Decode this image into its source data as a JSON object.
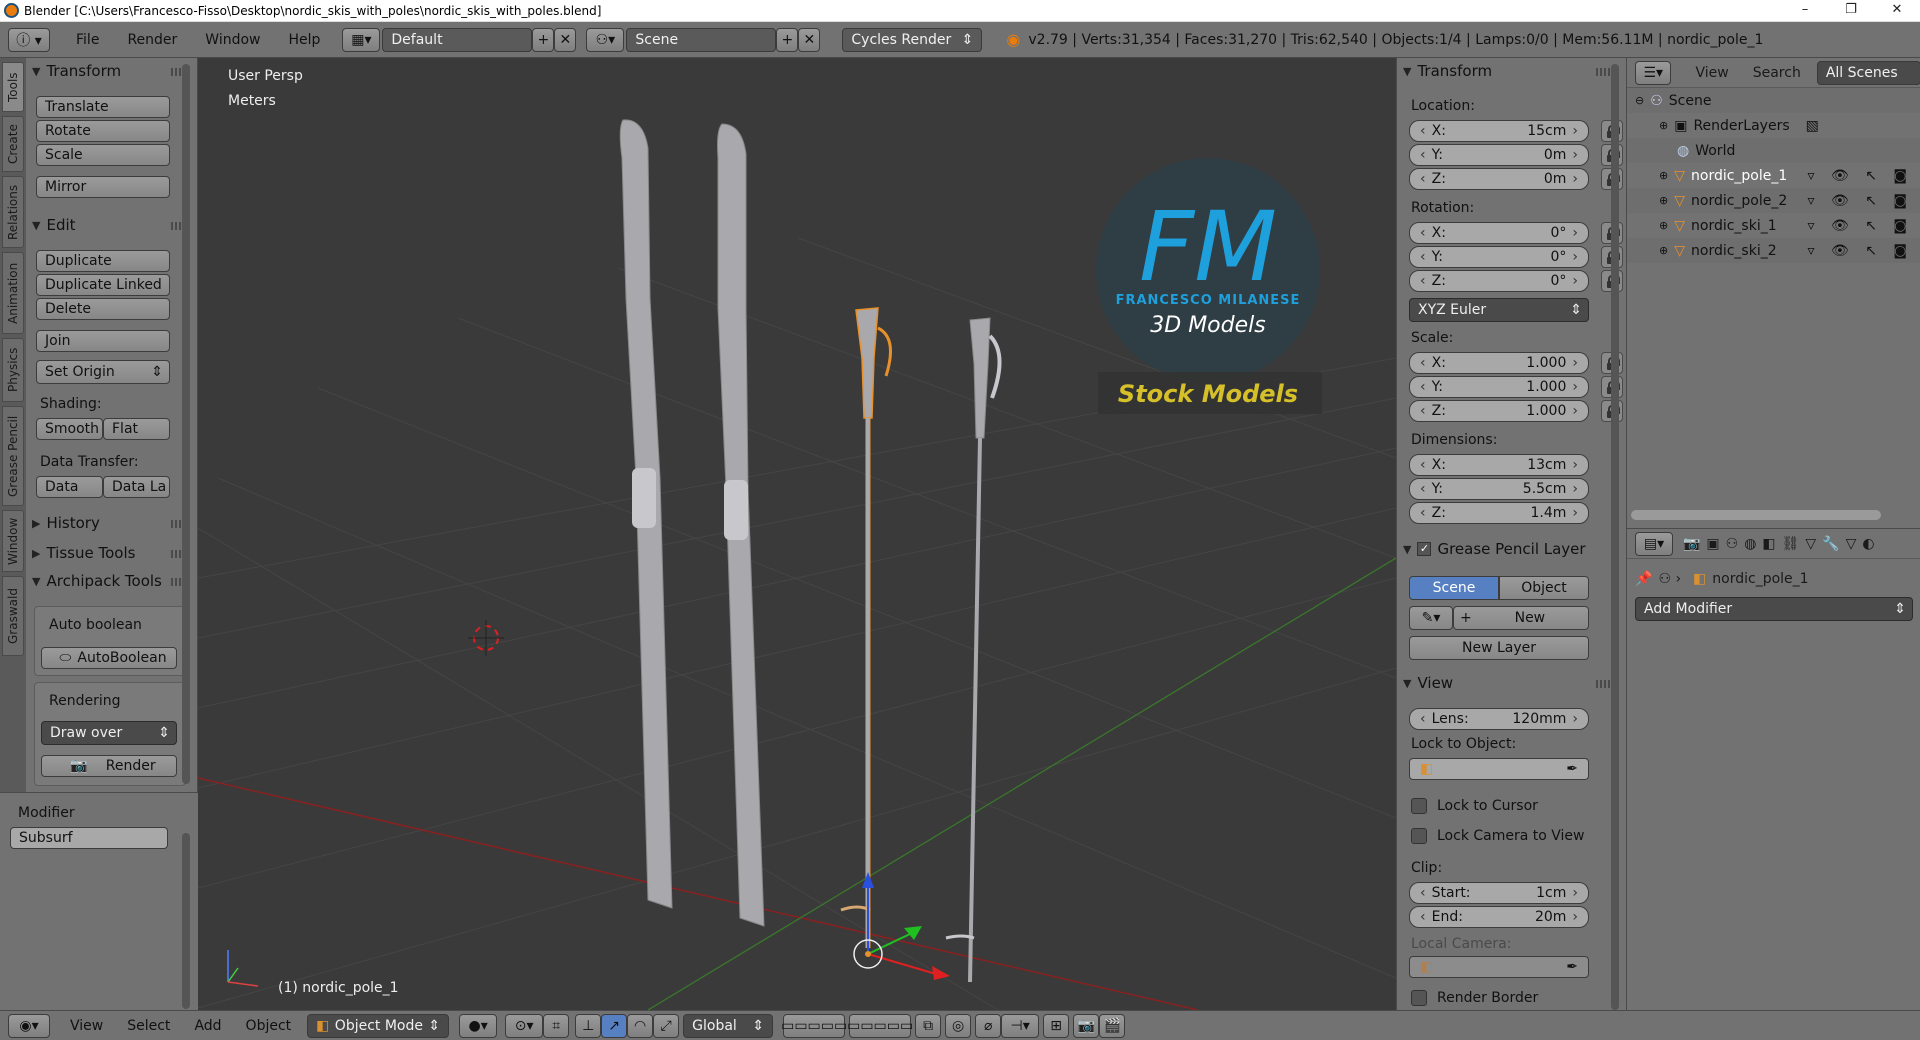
{
  "window": {
    "title": "Blender [C:\\Users\\Francesco-Fisso\\Desktop\\nordic_skis_with_poles\\nordic_skis_with_poles.blend]",
    "minimize": "–",
    "maximize": "❐",
    "close": "✕"
  },
  "header": {
    "menus": [
      "File",
      "Render",
      "Window",
      "Help"
    ],
    "layout": "Default",
    "scene": "Scene",
    "engine": "Cycles Render",
    "stats": "v2.79 | Verts:31,354 | Faces:31,270 | Tris:62,540 | Objects:1/4 | Lamps:0/0 | Mem:56.11M | nordic_pole_1"
  },
  "left_tabs": [
    "Tools",
    "Create",
    "Relations",
    "Animation",
    "Physics",
    "Grease Pencil",
    "Window",
    "Graswald"
  ],
  "toolshelf": {
    "transform_title": "Transform",
    "translate": "Translate",
    "rotate": "Rotate",
    "scale": "Scale",
    "mirror": "Mirror",
    "edit_title": "Edit",
    "duplicate": "Duplicate",
    "duplicate_linked": "Duplicate Linked",
    "delete": "Delete",
    "join": "Join",
    "set_origin": "Set Origin",
    "shading_label": "Shading:",
    "smooth": "Smooth",
    "flat": "Flat",
    "data_transfer_label": "Data Transfer:",
    "data": "Data",
    "data_la": "Data La",
    "history": "History",
    "tissue_tools": "Tissue Tools",
    "archipack": "Archipack Tools",
    "auto_boolean_label": "Auto boolean",
    "autoboolean_btn": "AutoBoolean",
    "rendering_label": "Rendering",
    "draw_over": "Draw over",
    "render_btn": "Render"
  },
  "modifier_panel": {
    "title": "Modifier",
    "value": "Subsurf"
  },
  "viewport": {
    "view_name": "User Persp",
    "units": "Meters",
    "active_object": "(1) nordic_pole_1",
    "logo_letters": "FM",
    "logo_name": "FRANCESCO MILANESE",
    "logo_sub": "3D Models",
    "stock": "Stock Models"
  },
  "npanel": {
    "transform_title": "Transform",
    "location_label": "Location:",
    "location": [
      {
        "k": "X:",
        "v": "15cm"
      },
      {
        "k": "Y:",
        "v": "0m"
      },
      {
        "k": "Z:",
        "v": "0m"
      }
    ],
    "rotation_label": "Rotation:",
    "rotation": [
      {
        "k": "X:",
        "v": "0°"
      },
      {
        "k": "Y:",
        "v": "0°"
      },
      {
        "k": "Z:",
        "v": "0°"
      }
    ],
    "rotation_mode": "XYZ Euler",
    "scale_label": "Scale:",
    "scale": [
      {
        "k": "X:",
        "v": "1.000"
      },
      {
        "k": "Y:",
        "v": "1.000"
      },
      {
        "k": "Z:",
        "v": "1.000"
      }
    ],
    "dimensions_label": "Dimensions:",
    "dimensions": [
      {
        "k": "X:",
        "v": "13cm"
      },
      {
        "k": "Y:",
        "v": "5.5cm"
      },
      {
        "k": "Z:",
        "v": "1.4m"
      }
    ],
    "grease_title": "Grease Pencil Layer",
    "scene_tab": "Scene",
    "object_tab": "Object",
    "new": "New",
    "new_layer": "New Layer",
    "view_title": "View",
    "lens_k": "Lens:",
    "lens_v": "120mm",
    "lock_to_object": "Lock to Object:",
    "lock_to_cursor": "Lock to Cursor",
    "lock_camera": "Lock Camera to View",
    "clip_label": "Clip:",
    "clip_start_k": "Start:",
    "clip_start_v": "1cm",
    "clip_end_k": "End:",
    "clip_end_v": "20m",
    "local_camera": "Local Camera:",
    "render_border": "Render Border"
  },
  "outliner": {
    "view": "View",
    "search": "Search",
    "all_scenes": "All Scenes",
    "items": [
      {
        "name": "Scene",
        "indent": 0
      },
      {
        "name": "RenderLayers",
        "indent": 1
      },
      {
        "name": "World",
        "indent": 1
      },
      {
        "name": "nordic_pole_1",
        "indent": 1
      },
      {
        "name": "nordic_pole_2",
        "indent": 1
      },
      {
        "name": "nordic_ski_1",
        "indent": 1
      },
      {
        "name": "nordic_ski_2",
        "indent": 1
      }
    ]
  },
  "properties": {
    "object_name": "nordic_pole_1",
    "add_modifier": "Add Modifier"
  },
  "bottombar": {
    "view": "View",
    "select": "Select",
    "add": "Add",
    "object": "Object",
    "mode": "Object Mode",
    "orientation": "Global"
  },
  "colors": {
    "selected_outline": "#e8902a",
    "logo_blue": "#1ea0dc",
    "stock_yellow": "#d6c02a",
    "active_tab": "#5680c2"
  }
}
